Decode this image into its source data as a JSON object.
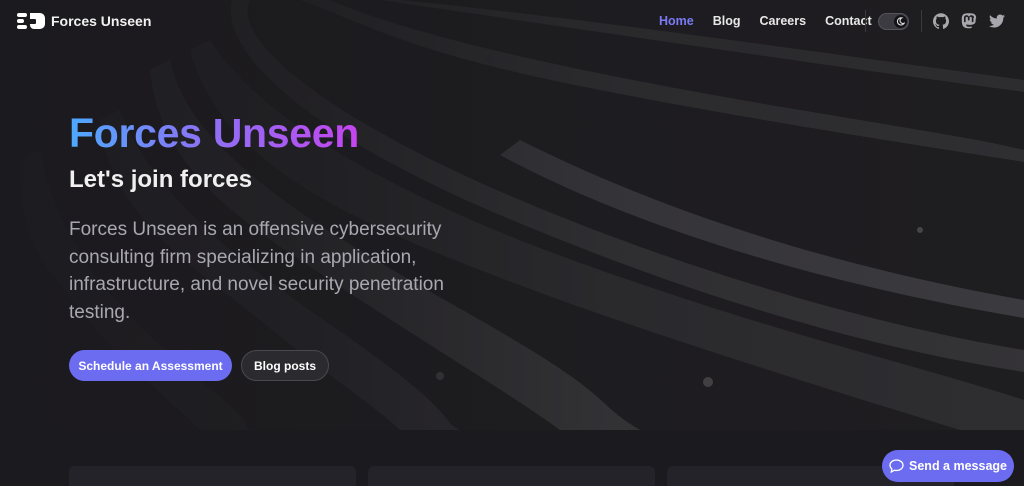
{
  "brand": {
    "name": "Forces Unseen",
    "logo_icon": "forces-unseen-logo"
  },
  "nav": {
    "items": [
      {
        "label": "Home",
        "active": true
      },
      {
        "label": "Blog",
        "active": false
      },
      {
        "label": "Careers",
        "active": false
      },
      {
        "label": "Contact",
        "active": false
      }
    ],
    "theme_toggle_icon": "moon-icon",
    "social_icons": [
      "github-icon",
      "mastodon-icon",
      "twitter-icon"
    ]
  },
  "hero": {
    "title": "Forces Unseen",
    "subtitle": "Let's join forces",
    "description": "Forces Unseen is an offensive cybersecurity consulting firm specializing in application, infrastructure, and novel security penetration testing.",
    "primary_button": "Schedule an Assessment",
    "secondary_button": "Blog posts"
  },
  "chat": {
    "label": "Send a message",
    "icon": "chat-bubble-icon"
  },
  "colors": {
    "accent": "#6c6cf0",
    "active_nav": "#7b7bf5",
    "background": "#1b1a1e",
    "title_gradient_start": "#4da9ff",
    "title_gradient_end": "#c544f0"
  }
}
